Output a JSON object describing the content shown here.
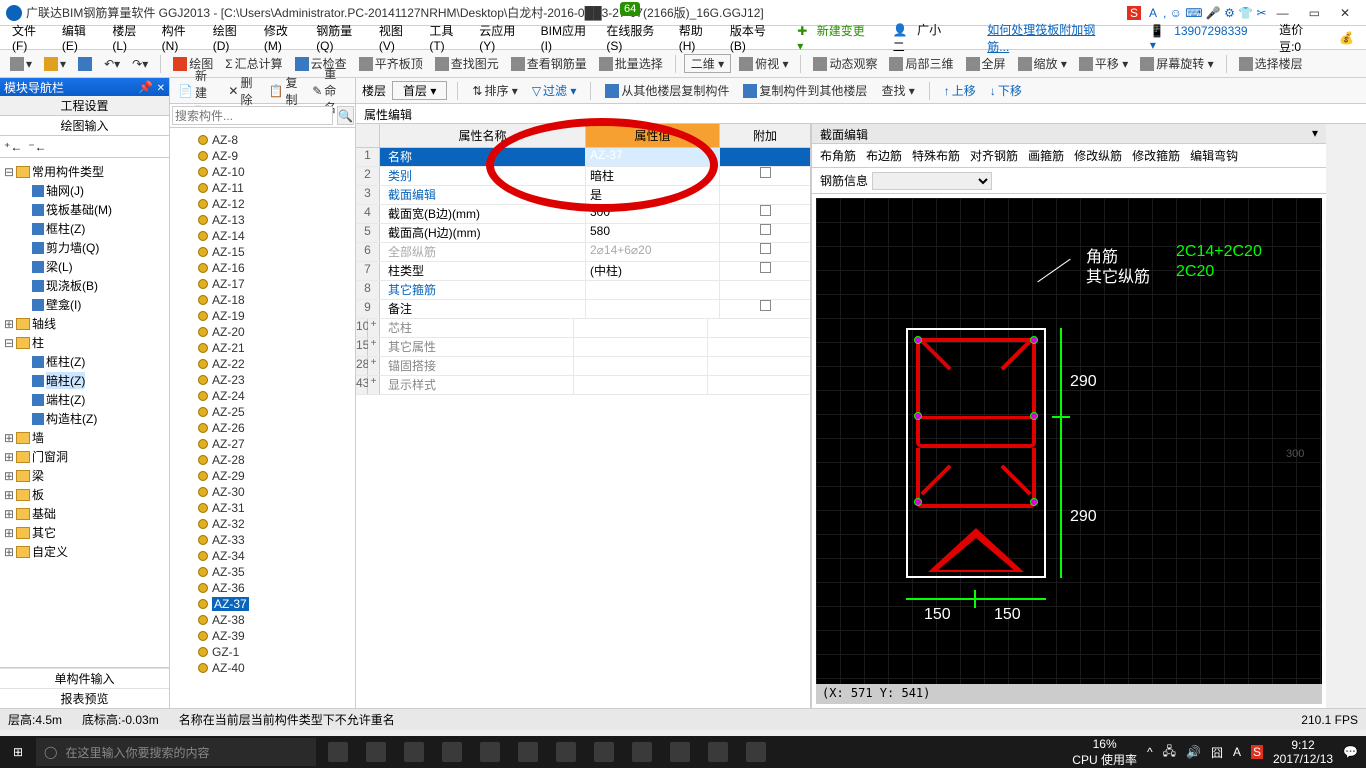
{
  "title": "广联达BIM钢筋算量软件 GGJ2013 - [C:\\Users\\Administrator.PC-20141127NRHM\\Desktop\\白龙村-2016-0██3-27-07(2166版)_16G.GGJ12]",
  "topbadge": "64",
  "menus": [
    "文件(F)",
    "编辑(E)",
    "楼层(L)",
    "构件(N)",
    "绘图(D)",
    "修改(M)",
    "钢筋量(Q)",
    "视图(V)",
    "工具(T)",
    "云应用(Y)",
    "BIM应用(I)",
    "在线服务(S)",
    "帮助(H)",
    "版本号(B)"
  ],
  "menu_new": "新建变更 ▾",
  "menu_user": "广小二",
  "menu_link": "如何处理筏板附加钢筋...",
  "menu_phone": "13907298339 ▾",
  "menu_bean": "造价豆:0",
  "tb1": [
    "绘图",
    "汇总计算",
    "云检查",
    "平齐板顶",
    "查找图元",
    "查看钢筋量",
    "批量选择",
    "二维 ▾",
    "俯视 ▾",
    "动态观察",
    "局部三维",
    "全屏",
    "缩放 ▾",
    "平移 ▾",
    "屏幕旋转 ▾",
    "选择楼层"
  ],
  "tb2": [
    "新建 ▾",
    "删除",
    "复制",
    "重命名",
    "楼层",
    "首层",
    "排序 ▾",
    "过滤 ▾",
    "从其他楼层复制构件",
    "复制构件到其他楼层",
    "查找 ▾",
    "上移",
    "下移"
  ],
  "nav": {
    "title": "模块导航栏",
    "tab1": "工程设置",
    "tab2": "绘图输入",
    "btm1": "单构件输入",
    "btm2": "报表预览"
  },
  "tree": [
    {
      "l": 0,
      "t": "−",
      "f": 1,
      "txt": "常用构件类型"
    },
    {
      "l": 1,
      "ic": "b",
      "txt": "轴网(J)"
    },
    {
      "l": 1,
      "ic": "b",
      "txt": "筏板基础(M)"
    },
    {
      "l": 1,
      "ic": "b",
      "txt": "框柱(Z)"
    },
    {
      "l": 1,
      "ic": "b",
      "txt": "剪力墙(Q)"
    },
    {
      "l": 1,
      "ic": "b",
      "txt": "梁(L)"
    },
    {
      "l": 1,
      "ic": "b",
      "txt": "现浇板(B)"
    },
    {
      "l": 1,
      "ic": "b",
      "txt": "壁龛(I)"
    },
    {
      "l": 0,
      "t": "+",
      "f": 1,
      "txt": "轴线"
    },
    {
      "l": 0,
      "t": "−",
      "f": 1,
      "txt": "柱"
    },
    {
      "l": 1,
      "ic": "b",
      "txt": "框柱(Z)"
    },
    {
      "l": 1,
      "ic": "b",
      "txt": "暗柱(Z)",
      "sel": 1
    },
    {
      "l": 1,
      "ic": "b",
      "txt": "端柱(Z)"
    },
    {
      "l": 1,
      "ic": "b",
      "txt": "构造柱(Z)"
    },
    {
      "l": 0,
      "t": "+",
      "f": 1,
      "txt": "墙"
    },
    {
      "l": 0,
      "t": "+",
      "f": 1,
      "txt": "门窗洞"
    },
    {
      "l": 0,
      "t": "+",
      "f": 1,
      "txt": "梁"
    },
    {
      "l": 0,
      "t": "+",
      "f": 1,
      "txt": "板"
    },
    {
      "l": 0,
      "t": "+",
      "f": 1,
      "txt": "基础"
    },
    {
      "l": 0,
      "t": "+",
      "f": 1,
      "txt": "其它"
    },
    {
      "l": 0,
      "t": "+",
      "f": 1,
      "txt": "自定义"
    }
  ],
  "search_ph": "搜索构件...",
  "list": [
    "AZ-8",
    "AZ-9",
    "AZ-10",
    "AZ-11",
    "AZ-12",
    "AZ-13",
    "AZ-14",
    "AZ-15",
    "AZ-16",
    "AZ-17",
    "AZ-18",
    "AZ-19",
    "AZ-20",
    "AZ-21",
    "AZ-22",
    "AZ-23",
    "AZ-24",
    "AZ-25",
    "AZ-26",
    "AZ-27",
    "AZ-28",
    "AZ-29",
    "AZ-30",
    "AZ-31",
    "AZ-32",
    "AZ-33",
    "AZ-34",
    "AZ-35",
    "AZ-36",
    "AZ-37",
    "AZ-38",
    "AZ-39",
    "GZ-1",
    "AZ-40"
  ],
  "list_sel": "AZ-37",
  "prop": {
    "title": "属性编辑",
    "h1": "属性名称",
    "h2": "属性值",
    "h3": "附加"
  },
  "rows": [
    {
      "n": "1",
      "k": "名称",
      "v": "AZ-37",
      "hl": 1,
      "sel": 1,
      "blue": 1
    },
    {
      "n": "2",
      "k": "类别",
      "v": "暗柱",
      "blue": 1,
      "chk": 1
    },
    {
      "n": "3",
      "k": "截面编辑",
      "v": "是",
      "blue": 1
    },
    {
      "n": "4",
      "k": "截面宽(B边)(mm)",
      "v": "300",
      "chk": 1
    },
    {
      "n": "5",
      "k": "截面高(H边)(mm)",
      "v": "580",
      "chk": 1
    },
    {
      "n": "6",
      "k": "全部纵筋",
      "v": "2⌀14+6⌀20",
      "chk": 1,
      "dim": 1
    },
    {
      "n": "7",
      "k": "柱类型",
      "v": "(中柱)",
      "chk": 1
    },
    {
      "n": "8",
      "k": "其它箍筋",
      "v": "",
      "blue": 1
    },
    {
      "n": "9",
      "k": "备注",
      "v": "",
      "chk": 1
    },
    {
      "n": "10",
      "k": "芯柱",
      "exp": "+"
    },
    {
      "n": "15",
      "k": "其它属性",
      "exp": "+"
    },
    {
      "n": "28",
      "k": "锚固搭接",
      "exp": "+"
    },
    {
      "n": "43",
      "k": "显示样式",
      "exp": "+"
    }
  ],
  "sec": {
    "title": "截面编辑",
    "tabs": [
      "布角筋",
      "布边筋",
      "特殊布筋",
      "对齐钢筋",
      "画箍筋",
      "修改纵筋",
      "修改箍筋",
      "编辑弯钩"
    ],
    "info": "钢筋信息"
  },
  "canv": {
    "l1": "角筋",
    "l2": "其它纵筋",
    "g1": "2C14+2C20",
    "g2": "2C20",
    "d290a": "290",
    "d290b": "290",
    "d150a": "150",
    "d150b": "150",
    "d300": "300",
    "coords": "(X: 571 Y: 541)"
  },
  "sts": {
    "h": "层高:4.5m",
    "b": "底标高:-0.03m",
    "msg": "名称在当前层当前构件类型下不允许重名",
    "fps": "210.1 FPS"
  },
  "task": {
    "srch": "在这里输入你要搜索的内容",
    "cpu": "16%\nCPU 使用率",
    "time": "9:12",
    "date": "2017/12/13"
  }
}
